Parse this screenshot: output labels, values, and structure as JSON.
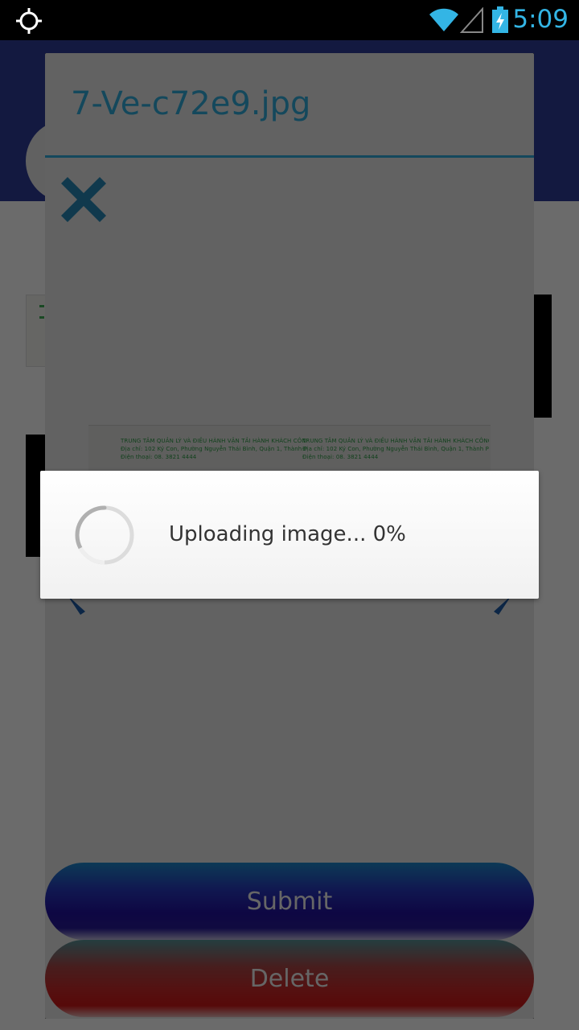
{
  "status_bar": {
    "time": "5:09",
    "icons": [
      "gps-icon",
      "wifi-icon",
      "signal-icon",
      "battery-charging-icon"
    ]
  },
  "preview_dialog": {
    "title": "7-Ve-c72e9.jpg",
    "close_icon": "close-icon",
    "image_text": {
      "line1": "TRUNG TÂM QUẢN LÝ VÀ ĐIỀU HÀNH VẬN TẢI HÀNH KHÁCH CÔNG CỘNG",
      "line2": "Địa chỉ: 102 Ký Con, Phường Nguyễn Thái Bình, Quận 1, Thành Phố Hồ Chí Minh",
      "line3": "Điện thoại: 08. 3821 4444"
    },
    "submit_label": "Submit",
    "delete_label": "Delete"
  },
  "progress_dialog": {
    "message": "Uploading image... 0%",
    "progress_percent": 0
  },
  "colors": {
    "accent": "#33b5e5",
    "header": "#2f3d9a",
    "submit": "#2412a8",
    "delete": "#d42a2a"
  }
}
